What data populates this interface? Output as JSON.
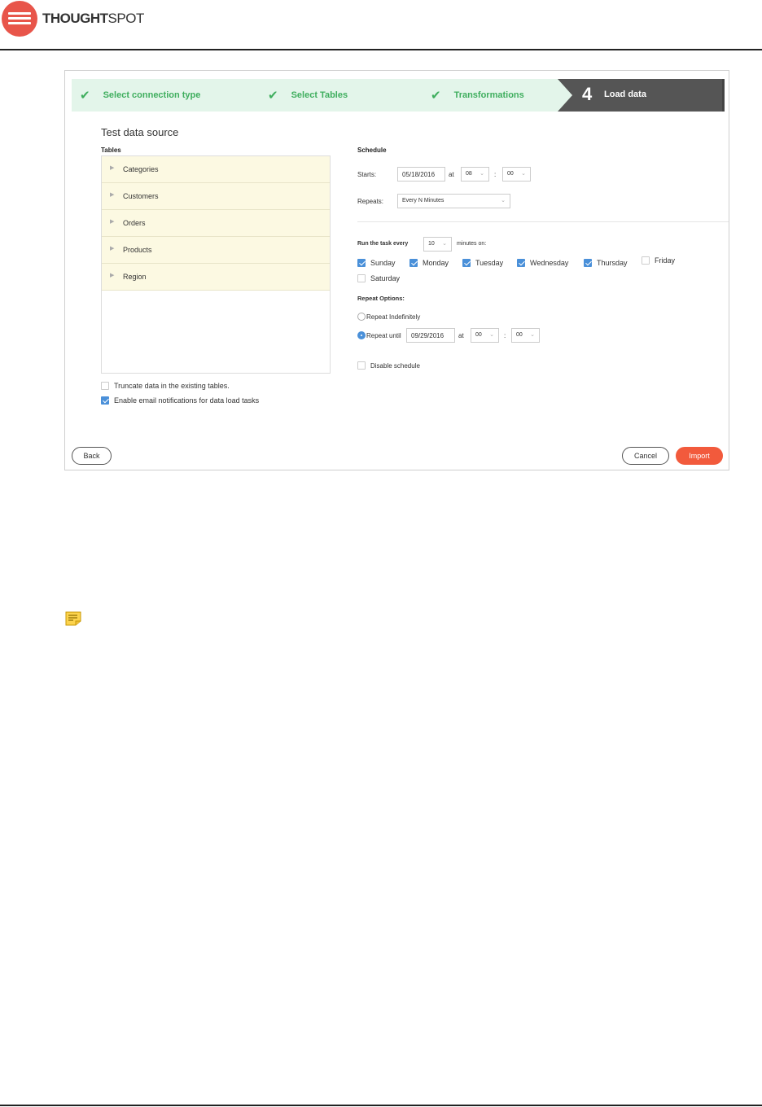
{
  "brand": {
    "logo_bold": "THOUGHT",
    "logo_light": "SPOT"
  },
  "wizard": {
    "steps": [
      {
        "label": "Select connection type",
        "status": "done"
      },
      {
        "label": "Select Tables",
        "status": "done"
      },
      {
        "label": "Transformations",
        "status": "done"
      },
      {
        "number": "4",
        "label": "Load data",
        "status": "active"
      }
    ]
  },
  "left": {
    "title": "Test data source",
    "tables_label": "Tables",
    "tables": [
      "Categories",
      "Customers",
      "Orders",
      "Products",
      "Region"
    ],
    "truncate_label": "Truncate data in the existing tables.",
    "truncate_checked": false,
    "email_label": "Enable email notifications for data load tasks",
    "email_checked": true
  },
  "schedule": {
    "heading": "Schedule",
    "starts_label": "Starts:",
    "start_date": "05/18/2016",
    "at": "at",
    "start_hour": "08",
    "colon": ":",
    "start_minute": "00",
    "repeats_label": "Repeats:",
    "repeats_value": "Every N Minutes",
    "run_every_label": "Run the task every",
    "run_every_value": "10",
    "minutes_on": "minutes on:",
    "days": [
      {
        "label": "Sunday",
        "checked": true
      },
      {
        "label": "Monday",
        "checked": true
      },
      {
        "label": "Tuesday",
        "checked": true
      },
      {
        "label": "Wednesday",
        "checked": true
      },
      {
        "label": "Thursday",
        "checked": true
      },
      {
        "label": "Friday",
        "checked": false
      },
      {
        "label": "Saturday",
        "checked": false
      }
    ],
    "repeat_options_label": "Repeat Options:",
    "repeat_indefinitely": "Repeat Indefinitely",
    "repeat_until": "Repeat until",
    "until_date": "09/29/2016",
    "until_hour": "00",
    "until_minute": "00",
    "disable_label": "Disable schedule"
  },
  "buttons": {
    "back": "Back",
    "cancel": "Cancel",
    "import": "Import"
  },
  "colors": {
    "accent": "#f25a3c",
    "check_green": "#3fae5e",
    "checkbox_blue": "#4a90d9",
    "step_active": "#555555"
  }
}
